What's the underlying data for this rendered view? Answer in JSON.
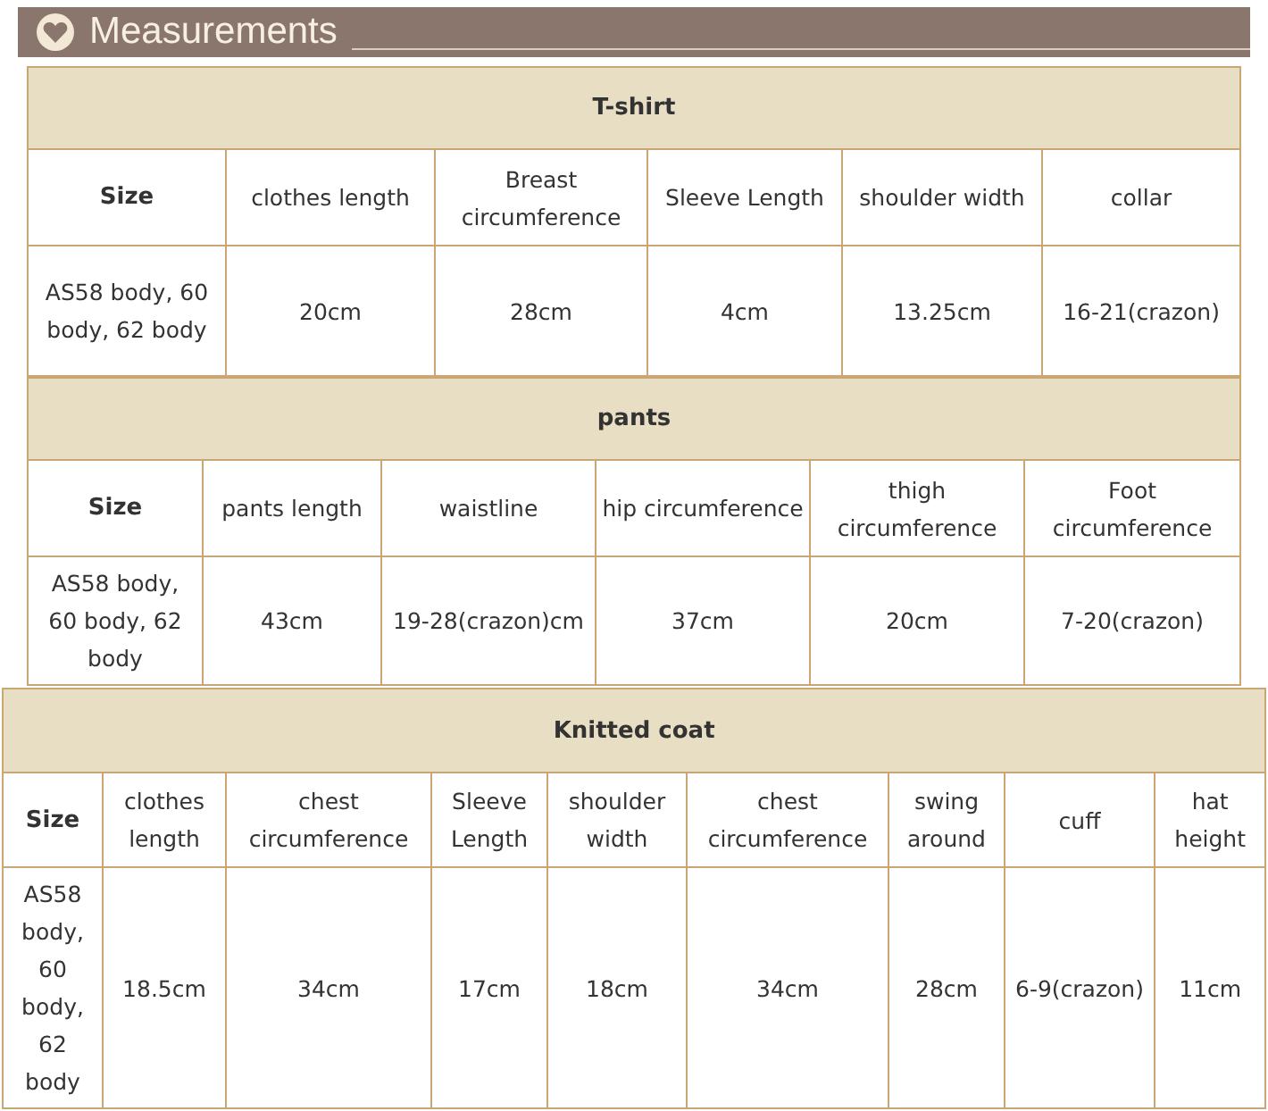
{
  "header": {
    "title": "Measurements"
  },
  "tables": [
    {
      "title": "T-shirt",
      "columns": [
        "Size",
        "clothes length",
        "Breast circumference",
        "Sleeve Length",
        "shoulder width",
        "collar"
      ],
      "rows": [
        [
          "AS58 body, 60 body, 62 body",
          "20cm",
          "28cm",
          "4cm",
          "13.25cm",
          "16-21(crazon)"
        ]
      ]
    },
    {
      "title": "pants",
      "columns": [
        "Size",
        "pants length",
        "waistline",
        "hip circumference",
        "thigh circumference",
        "Foot circumference"
      ],
      "rows": [
        [
          "AS58 body, 60 body, 62 body",
          "43cm",
          "19-28(crazon)cm",
          "37cm",
          "20cm",
          "7-20(crazon)"
        ]
      ]
    },
    {
      "title": "Knitted coat",
      "columns": [
        "Size",
        "clothes length",
        "chest circumference",
        "Sleeve Length",
        "shoulder width",
        "chest circumference",
        "swing around",
        "cuff",
        "hat height"
      ],
      "rows": [
        [
          "AS58 body, 60 body, 62 body",
          "18.5cm",
          "34cm",
          "17cm",
          "18cm",
          "34cm",
          "28cm",
          "6-9(crazon)",
          "11cm"
        ]
      ]
    }
  ]
}
